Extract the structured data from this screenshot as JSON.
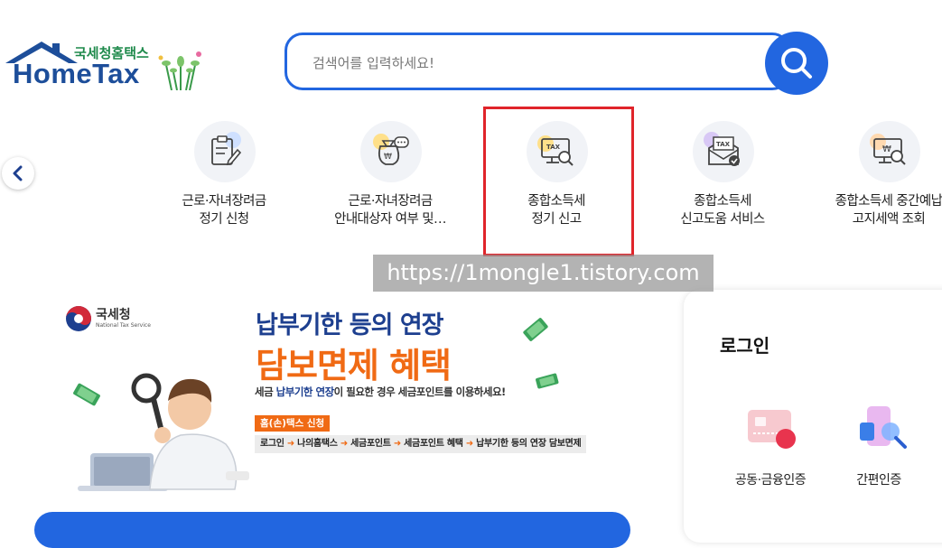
{
  "brand": {
    "name_kr": "국세청홈택스",
    "name_en": "HomeTax"
  },
  "search": {
    "placeholder": "검색어를 입력하세요!",
    "button_icon": "search-icon"
  },
  "quick_menu": {
    "prev_icon": "chevron-left-icon",
    "items": [
      {
        "line1": "근로·자녀장려금",
        "line2": "정기 신청",
        "icon": "form-pencil-icon"
      },
      {
        "line1": "근로·자녀장려금",
        "line2": "안내대상자 여부 및…",
        "icon": "money-bag-chat-icon"
      },
      {
        "line1": "종합소득세",
        "line2": "정기 신고",
        "icon": "tax-monitor-search-icon"
      },
      {
        "line1": "종합소득세",
        "line2": "신고도움 서비스",
        "icon": "tax-envelope-check-icon"
      },
      {
        "line1": "종합소득세 중간예납",
        "line2": "고지세액 조회",
        "icon": "monitor-won-search-icon"
      }
    ]
  },
  "watermark": "https://1mongle1.tistory.com",
  "banner": {
    "org_name": "국세청",
    "org_name_en": "National Tax Service",
    "title1": "납부기한 등의 연장",
    "title2": "담보면제 혜택",
    "subtitle_pre": "세금 ",
    "subtitle_bold": "납부기한 연장",
    "subtitle_post": "이 필요한 경우 세금포인트를 이용하세요!",
    "tag": "홈(손)택스 신청",
    "path": [
      "로그인",
      "나의홈택스",
      "세금포인트",
      "세금포인트 혜택",
      "납부기한 등의 연장 담보면제"
    ]
  },
  "login": {
    "title": "로그인",
    "options": [
      {
        "label": "공동·금융인증",
        "icon": "certificate-card-icon"
      },
      {
        "label": "간편인증",
        "icon": "phone-search-icon"
      }
    ]
  },
  "colors": {
    "primary_blue": "#2266e0",
    "brand_navy": "#1d4e9a",
    "brand_green": "#1f8a4c",
    "accent_orange": "#f06a14",
    "highlight_red": "#e0242a"
  }
}
